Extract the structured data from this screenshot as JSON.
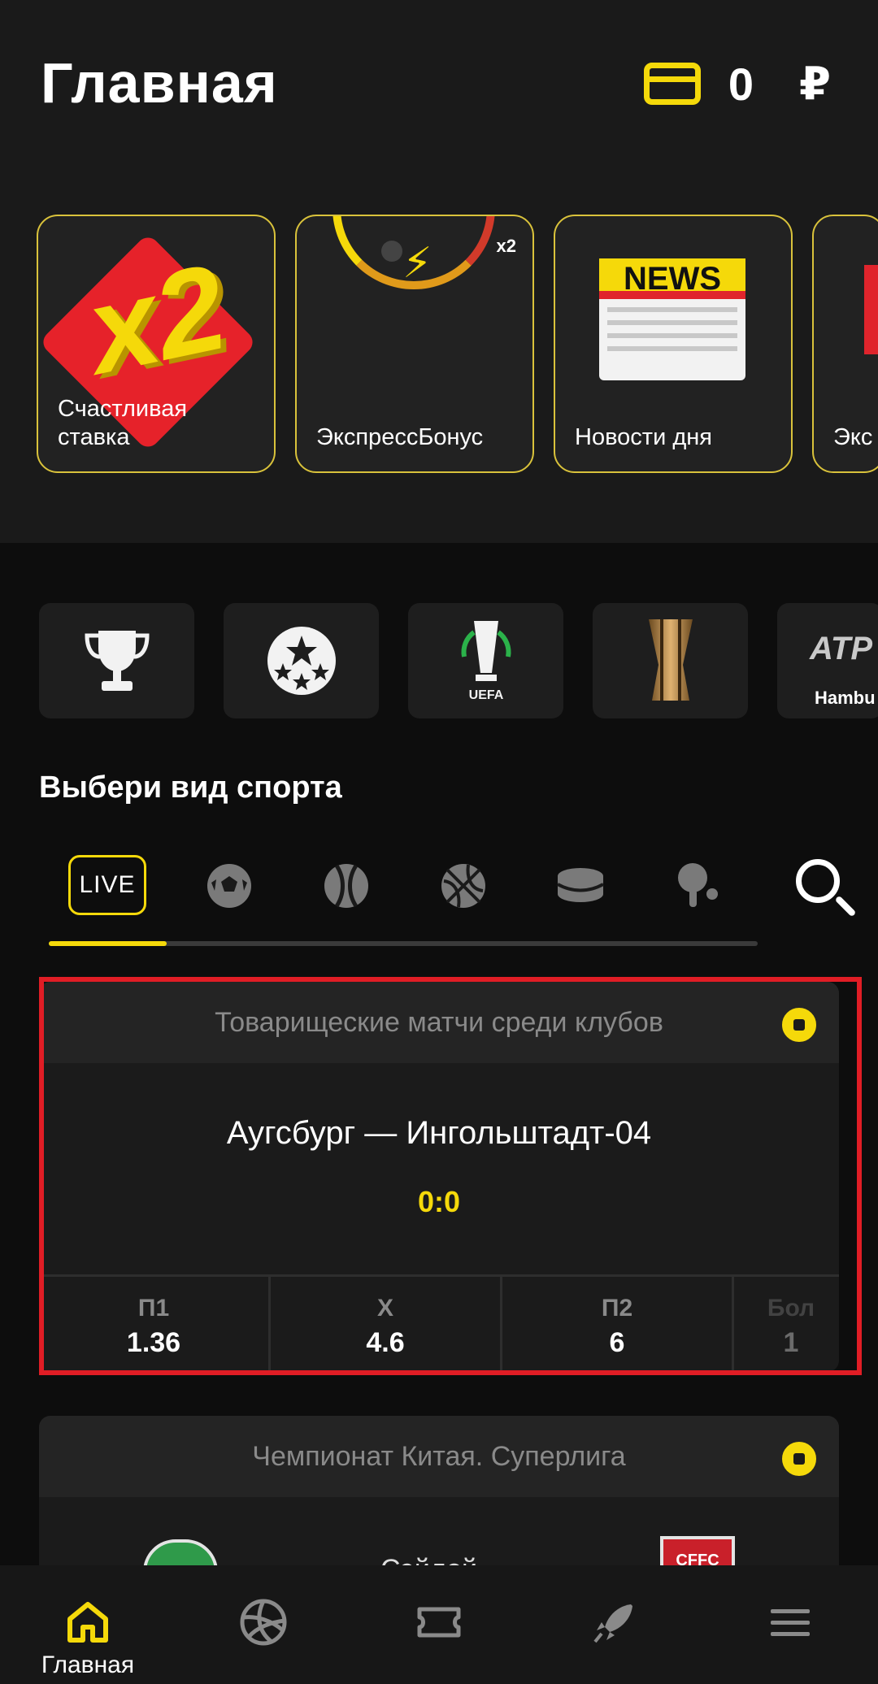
{
  "header": {
    "title": "Главная",
    "balance": "0",
    "currency": "₽",
    "wallet_icon": "wallet-icon"
  },
  "promos": [
    {
      "label": "Счастливая ставка",
      "icon": "x2-badge-icon"
    },
    {
      "label": "ЭкспрессБонус",
      "icon": "speed-gauge-icon"
    },
    {
      "label": "Новости дня",
      "icon": "newspaper-icon"
    },
    {
      "label": "Экс",
      "icon": "promo-icon"
    }
  ],
  "tournaments": [
    {
      "icon": "trophy-icon"
    },
    {
      "icon": "champions-league-icon"
    },
    {
      "icon": "conference-league-icon"
    },
    {
      "icon": "libertadores-trophy-icon"
    },
    {
      "icon": "atp-logo-icon",
      "label": "Hambu"
    }
  ],
  "section": {
    "title": "Выбери вид спорта"
  },
  "sport_tabs": [
    {
      "label": "LIVE",
      "selected": true
    },
    {
      "icon": "football-icon"
    },
    {
      "icon": "tennis-icon"
    },
    {
      "icon": "basketball-icon"
    },
    {
      "icon": "hockey-puck-icon"
    },
    {
      "icon": "table-tennis-icon"
    },
    {
      "icon": "search-icon"
    }
  ],
  "match": {
    "league": "Товарищеские матчи среди клубов",
    "teams": "Аугсбург — Ингольштадт-04",
    "score": "0:0",
    "odds": [
      {
        "label": "П1",
        "value": "1.36"
      },
      {
        "label": "Х",
        "value": "4.6"
      },
      {
        "label": "П2",
        "value": "6"
      },
      {
        "label": "Бол",
        "value": "1"
      }
    ]
  },
  "match2": {
    "league": "Чемпионат Китая. Суперлига",
    "team_peek": "Сэйлой",
    "logo2_text": "CFFC"
  },
  "nav": [
    {
      "label": "Главная",
      "icon": "home-icon",
      "active": true
    },
    {
      "icon": "volleyball-icon"
    },
    {
      "icon": "ticket-icon"
    },
    {
      "icon": "rocket-icon"
    },
    {
      "icon": "menu-icon"
    }
  ],
  "colors": {
    "accent": "#f5d90a",
    "highlight": "#e01d25",
    "background": "#0d0d0d",
    "card": "#1b1b1b"
  }
}
